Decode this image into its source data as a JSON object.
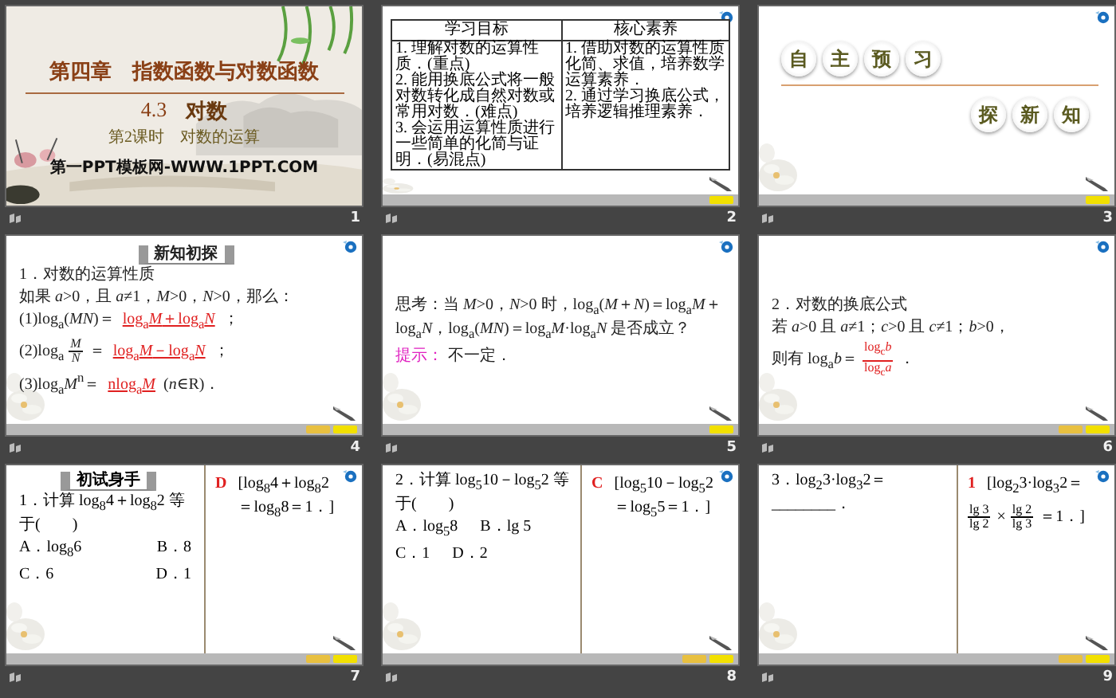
{
  "slides": [
    {
      "number": "1",
      "kind": "title",
      "chapter": "第四章　指数函数与对数函数",
      "lesson_number": "4.3",
      "lesson_title": "对数",
      "subtitle": "第2课时　对数的运算",
      "site": "第一PPT模板网-WWW.1PPT.COM"
    },
    {
      "number": "2",
      "kind": "table",
      "nav_buttons": [
        {
          "color": "#f2e000"
        }
      ],
      "columns": [
        {
          "heading": "学习目标",
          "items": [
            "1. 理解对数的运算性质．(重点)",
            "2. 能用换底公式将一般对数转化成自然对数或常用对数．(难点)",
            "3. 会运用运算性质进行一些简单的化简与证明．(易混点)"
          ]
        },
        {
          "heading": "核心素养",
          "items": [
            "1. 借助对数的运算性质化简、求值，培养数学运算素养．",
            "2. 通过学习换底公式，培养逻辑推理素养．"
          ]
        }
      ]
    },
    {
      "number": "3",
      "kind": "section",
      "nav_buttons": [
        {
          "color": "#f2e000"
        }
      ],
      "top_chars": [
        "自",
        "主",
        "预",
        "习"
      ],
      "bottom_chars": [
        "探",
        "新",
        "知"
      ]
    },
    {
      "number": "4",
      "kind": "text",
      "nav_buttons": [
        {
          "color": "#e8c040"
        },
        {
          "color": "#f2e000"
        }
      ],
      "header": "新知初探",
      "lines": [
        {
          "parts": [
            {
              "kind": "text",
              "text": "1．对数的运算性质"
            }
          ]
        },
        {
          "parts": [
            {
              "kind": "text",
              "text": "如果 *a*>0，且 *a*≠1，*M*>0，*N*>0，那么："
            }
          ]
        },
        {
          "parts": [
            {
              "kind": "text",
              "text": "(1)log$_{a}$(*MN*)＝"
            },
            {
              "kind": "answer",
              "text": "log$_{a}$*M*＋log$_{a}$*N*"
            },
            {
              "kind": "text",
              "text": "；"
            }
          ]
        },
        {
          "parts": [
            {
              "kind": "text",
              "text": "(2)log$_{a}$"
            },
            {
              "kind": "fraction",
              "answer": false,
              "num": "*M*",
              "den": "*N*"
            },
            {
              "kind": "text",
              "text": "＝"
            },
            {
              "kind": "answer",
              "text": "log$_{a}$*M*－log$_{a}$*N*"
            },
            {
              "kind": "text",
              "text": "；"
            }
          ]
        },
        {
          "parts": [
            {
              "kind": "text",
              "text": "(3)log$_{a}$*M*$^{n}$＝"
            },
            {
              "kind": "answer",
              "text": "nlog$_{a}$*M*"
            },
            {
              "kind": "text",
              "text": "(*n*∈R)．"
            }
          ]
        }
      ]
    },
    {
      "number": "5",
      "kind": "text",
      "nav_buttons": [
        {
          "color": "#f2e000"
        }
      ],
      "lines": [
        {
          "parts": [
            {
              "kind": "text",
              "text": "思考：当 *M*>0，*N*>0 时，log$_{a}$(*M*＋*N*)＝log$_{a}$*M*＋log$_{a}$*N*，log$_{a}$(*MN*)＝log$_{a}$*M*·log$_{a}$*N* 是否成立？"
            }
          ]
        },
        {
          "parts": [
            {
              "kind": "hint",
              "text": "提示："
            },
            {
              "kind": "text",
              "text": "不一定．"
            }
          ]
        }
      ]
    },
    {
      "number": "6",
      "kind": "text",
      "nav_buttons": [
        {
          "color": "#e8c040"
        },
        {
          "color": "#f2e000"
        }
      ],
      "lines": [
        {
          "parts": [
            {
              "kind": "text",
              "text": "2．对数的换底公式"
            }
          ]
        },
        {
          "parts": [
            {
              "kind": "text",
              "text": "若 *a*>0 且 *a*≠1；*c*>0 且 *c*≠1；*b*>0，"
            }
          ]
        },
        {
          "parts": [
            {
              "kind": "text",
              "text": "则有 log$_{a}$*b*＝"
            },
            {
              "kind": "fraction",
              "answer": true,
              "num": "log$_{c}$*b*",
              "den": "log$_{c}$*a*"
            },
            {
              "kind": "text",
              "text": "．"
            }
          ]
        }
      ]
    },
    {
      "number": "7",
      "kind": "split",
      "nav_buttons": [
        {
          "color": "#e8c040"
        },
        {
          "color": "#f2e000"
        }
      ],
      "header": "初试身手",
      "left": [
        {
          "parts": [
            {
              "kind": "text",
              "text": "1．计算 log$_{8}$4＋log$_{8}$2 等于(　　)"
            }
          ]
        },
        {
          "spread": true,
          "parts": [
            {
              "kind": "text",
              "text": "A．log$_{8}$6"
            },
            {
              "kind": "text",
              "text": "B．8"
            }
          ]
        },
        {
          "spread": true,
          "parts": [
            {
              "kind": "text",
              "text": "C．6"
            },
            {
              "kind": "text",
              "text": "D．1"
            }
          ]
        }
      ],
      "right": [
        {
          "parts": [
            {
              "kind": "letter",
              "text": "D"
            },
            {
              "kind": "text",
              "text": "[log$_{8}$4＋log$_{8}$2＝log$_{8}$8＝1．]"
            }
          ]
        }
      ]
    },
    {
      "number": "8",
      "kind": "split",
      "nav_buttons": [
        {
          "color": "#e8c040"
        },
        {
          "color": "#f2e000"
        }
      ],
      "left": [
        {
          "parts": [
            {
              "kind": "text",
              "text": "2．计算 log$_{5}$10－log$_{5}$2 等于(　　)"
            }
          ]
        },
        {
          "parts": [
            {
              "kind": "text",
              "text": "A．log$_{5}$8"
            },
            {
              "kind": "text",
              "text": "B．lg 5"
            }
          ]
        },
        {
          "parts": [
            {
              "kind": "text",
              "text": "C．1"
            },
            {
              "kind": "text",
              "text": "D．2"
            }
          ]
        }
      ],
      "right": [
        {
          "parts": [
            {
              "kind": "letter",
              "text": "C"
            },
            {
              "kind": "text",
              "text": "[log$_{5}$10－log$_{5}$2＝log$_{5}$5＝1．]"
            }
          ]
        }
      ]
    },
    {
      "number": "9",
      "kind": "split",
      "nav_buttons": [
        {
          "color": "#e8c040"
        },
        {
          "color": "#f2e000"
        }
      ],
      "left": [
        {
          "parts": [
            {
              "kind": "text",
              "text": "3．log$_{2}$3·log$_{3}$2＝________．"
            }
          ]
        }
      ],
      "right": [
        {
          "parts": [
            {
              "kind": "letter",
              "text": "1"
            },
            {
              "kind": "text",
              "text": "[log$_{2}$3·log$_{3}$2＝"
            },
            {
              "kind": "fraction",
              "answer": false,
              "num": "lg 3",
              "den": "lg 2"
            },
            {
              "kind": "text",
              "text": "×"
            },
            {
              "kind": "fraction",
              "answer": false,
              "num": "lg 2",
              "den": "lg 3"
            },
            {
              "kind": "text",
              "text": "＝1．]"
            }
          ]
        }
      ]
    }
  ]
}
